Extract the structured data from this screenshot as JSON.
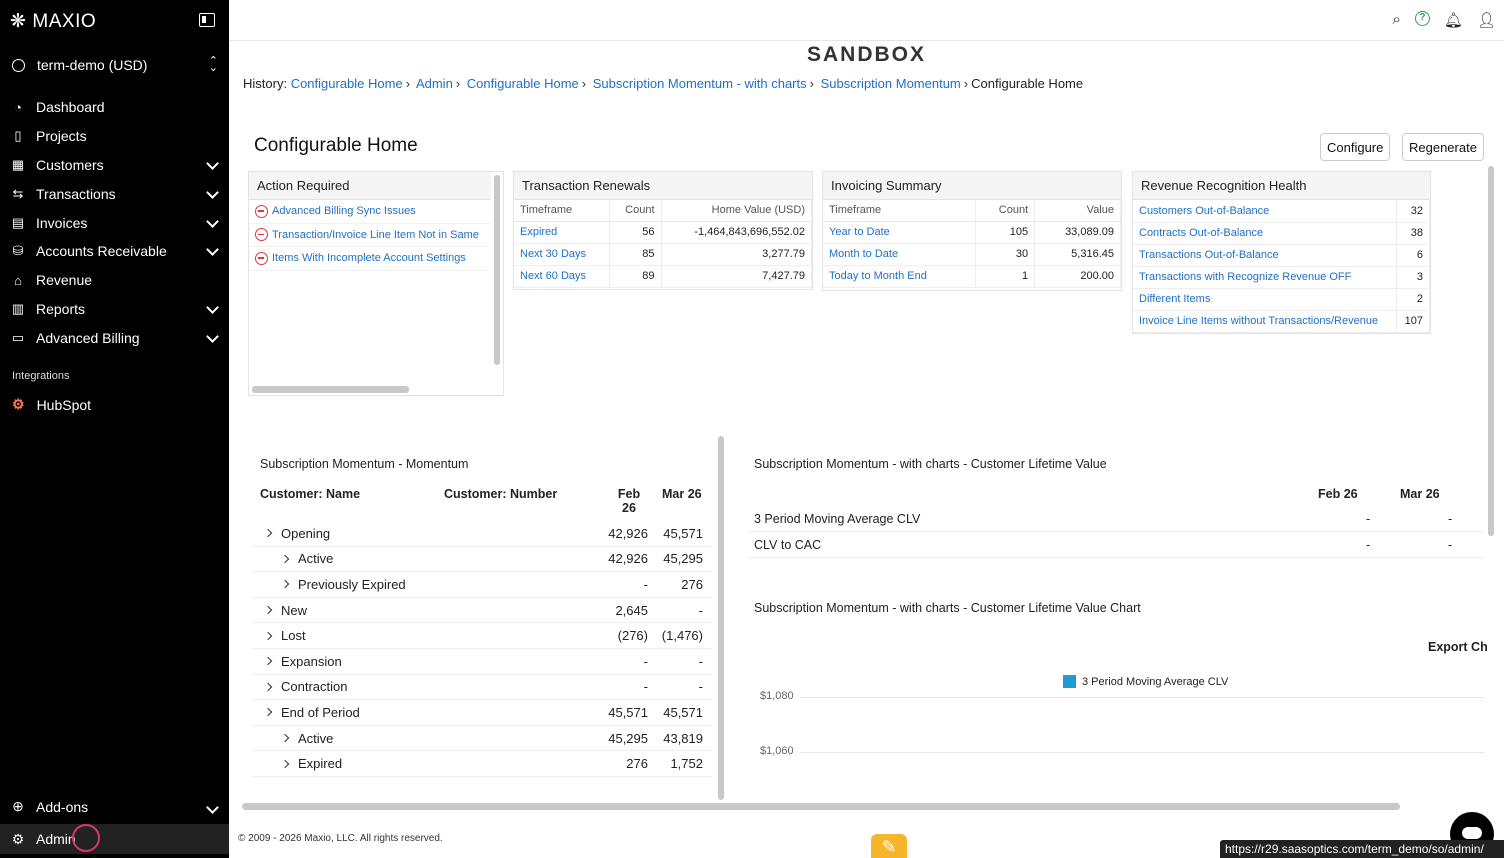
{
  "sidebar": {
    "logo": "MAXIO",
    "logo_icon": "snowflake-icon",
    "account": "term-demo (USD)",
    "items": [
      {
        "label": "Dashboard",
        "icon": "dashboard-icon",
        "expandable": false
      },
      {
        "label": "Projects",
        "icon": "clipboard-icon",
        "expandable": false
      },
      {
        "label": "Customers",
        "icon": "building-icon",
        "expandable": true
      },
      {
        "label": "Transactions",
        "icon": "arrows-icon",
        "expandable": true
      },
      {
        "label": "Invoices",
        "icon": "document-icon",
        "expandable": true
      },
      {
        "label": "Accounts Receivable",
        "icon": "coins-icon",
        "expandable": true
      },
      {
        "label": "Revenue",
        "icon": "bank-icon",
        "expandable": false
      },
      {
        "label": "Reports",
        "icon": "bar-chart-icon",
        "expandable": true
      },
      {
        "label": "Advanced Billing",
        "icon": "billing-icon",
        "expandable": true
      }
    ],
    "integrations_label": "Integrations",
    "hubspot": "HubSpot",
    "addons": "Add-ons",
    "admin": "Admin"
  },
  "header": {
    "env": "SANDBOX",
    "history_label": "History:",
    "history": [
      "Configurable Home",
      "Admin",
      "Configurable Home",
      "Subscription Momentum - with charts",
      "Subscription Momentum"
    ],
    "history_current": "Configurable Home"
  },
  "page": {
    "title": "Configurable Home",
    "configure": "Configure",
    "regenerate": "Regenerate"
  },
  "action_required": {
    "title": "Action Required",
    "items": [
      "Advanced Billing Sync Issues",
      "Transaction/Invoice Line Item Not in Same",
      "Items With Incomplete Account Settings"
    ]
  },
  "renewals": {
    "title": "Transaction Renewals",
    "columns": [
      "Timeframe",
      "Count",
      "Home Value (USD)"
    ],
    "rows": [
      [
        "Expired",
        "56",
        "-1,464,843,696,552.02"
      ],
      [
        "Next 30 Days",
        "85",
        "3,277.79"
      ],
      [
        "Next 60 Days",
        "89",
        "7,427.79"
      ]
    ]
  },
  "invoicing": {
    "title": "Invoicing Summary",
    "columns": [
      "Timeframe",
      "Count",
      "Value"
    ],
    "rows": [
      [
        "Year to Date",
        "105",
        "33,089.09"
      ],
      [
        "Month to Date",
        "30",
        "5,316.45"
      ],
      [
        "Today to Month End",
        "1",
        "200.00"
      ]
    ]
  },
  "rev_health": {
    "title": "Revenue Recognition Health",
    "rows": [
      [
        "Customers Out-of-Balance",
        "32"
      ],
      [
        "Contracts Out-of-Balance",
        "38"
      ],
      [
        "Transactions Out-of-Balance",
        "6"
      ],
      [
        "Transactions with Recognize Revenue OFF",
        "3"
      ],
      [
        "Different Items",
        "2"
      ],
      [
        "Invoice Line Items without Transactions/Revenue",
        "107"
      ]
    ]
  },
  "momentum": {
    "title": "Subscription Momentum - Momentum",
    "col_name": "Customer: Name",
    "col_number": "Customer: Number",
    "col_feb": "Feb 26",
    "col_mar": "Mar 26",
    "rows": [
      {
        "label": "Opening",
        "indent": 0,
        "feb": "42,926",
        "mar": "45,571"
      },
      {
        "label": "Active",
        "indent": 1,
        "feb": "42,926",
        "mar": "45,295"
      },
      {
        "label": "Previously Expired",
        "indent": 1,
        "feb": "-",
        "mar": "276"
      },
      {
        "label": "New",
        "indent": 0,
        "feb": "2,645",
        "mar": "-"
      },
      {
        "label": "Lost",
        "indent": 0,
        "feb": "(276)",
        "mar": "(1,476)"
      },
      {
        "label": "Expansion",
        "indent": 0,
        "feb": "-",
        "mar": "-"
      },
      {
        "label": "Contraction",
        "indent": 0,
        "feb": "-",
        "mar": "-"
      },
      {
        "label": "End of Period",
        "indent": 0,
        "feb": "45,571",
        "mar": "45,571"
      },
      {
        "label": "Active",
        "indent": 1,
        "feb": "45,295",
        "mar": "43,819"
      },
      {
        "label": "Expired",
        "indent": 1,
        "feb": "276",
        "mar": "1,752"
      }
    ]
  },
  "clv": {
    "title": "Subscription Momentum - with charts - Customer Lifetime Value",
    "col_feb": "Feb 26",
    "col_mar": "Mar 26",
    "rows": [
      [
        "3 Period Moving Average CLV",
        "-",
        "-"
      ],
      [
        "CLV to CAC",
        "-",
        "-"
      ]
    ],
    "chart_title": "Subscription Momentum - with charts - Customer Lifetime Value Chart",
    "export": "Export Ch",
    "legend": "3 Period Moving Average CLV",
    "legend_color": "#1f9bd5"
  },
  "chart_data": {
    "type": "line",
    "series": [
      {
        "name": "3 Period Moving Average CLV",
        "values": []
      }
    ],
    "yticks": [
      "$1,080",
      "$1,060"
    ]
  },
  "footer": "© 2009 - 2026 Maxio, LLC. All rights reserved.",
  "status_url": "https://r29.saasoptics.com/term_demo/so/admin/"
}
